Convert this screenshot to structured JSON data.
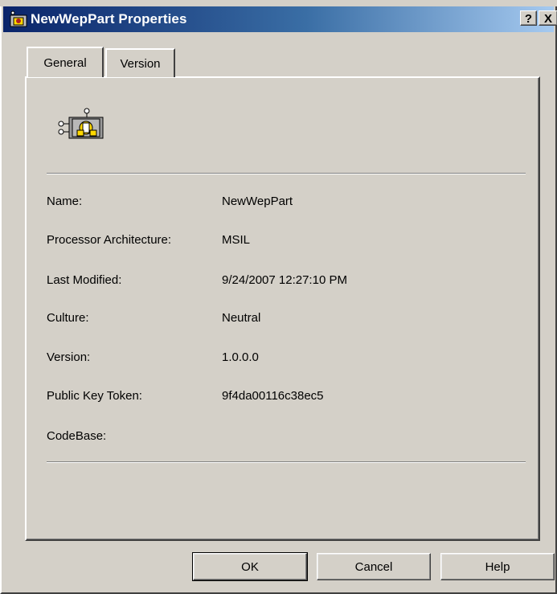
{
  "window": {
    "title": "NewWepPart Properties",
    "help_glyph": "?",
    "close_glyph": "X"
  },
  "tabs": [
    {
      "label": "General",
      "selected": true
    },
    {
      "label": "Version",
      "selected": false
    }
  ],
  "properties": [
    {
      "label": "Name:",
      "value": "NewWepPart"
    },
    {
      "label": "Processor Architecture:",
      "value": "MSIL"
    },
    {
      "label": "Last Modified:",
      "value": "9/24/2007 12:27:10 PM"
    },
    {
      "label": "Culture:",
      "value": "Neutral"
    },
    {
      "label": "Version:",
      "value": "1.0.0.0"
    },
    {
      "label": "Public Key Token:",
      "value": "9f4da00116c38ec5"
    },
    {
      "label": "CodeBase:",
      "value": ""
    }
  ],
  "buttons": {
    "ok": "OK",
    "cancel": "Cancel",
    "help": "Help"
  },
  "icons": {
    "app": "assembly-icon",
    "component": "assembly-component-icon"
  },
  "colors": {
    "face": "#d4d0c8",
    "title_start": "#0a246a",
    "title_end": "#a6caf0"
  }
}
